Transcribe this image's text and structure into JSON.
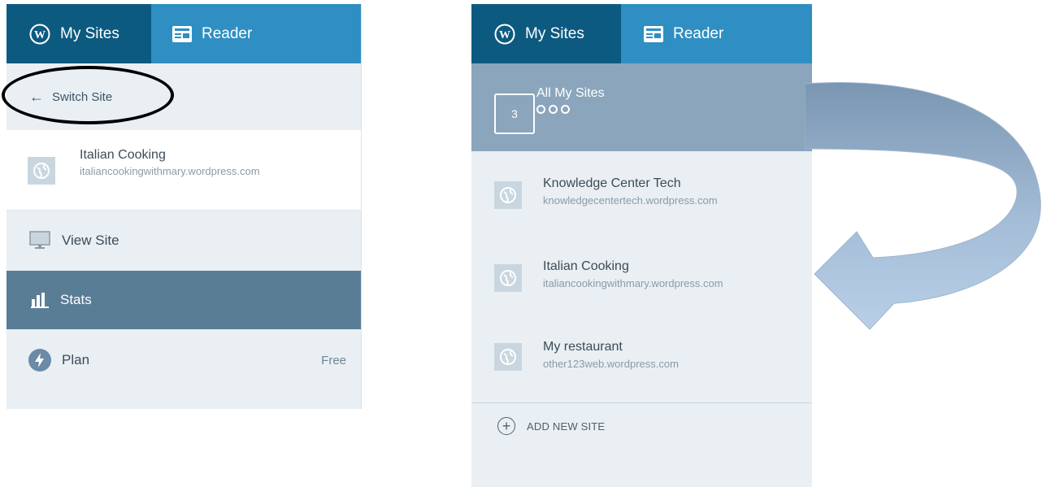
{
  "left": {
    "tabs": {
      "mysites": "My Sites",
      "reader": "Reader"
    },
    "switch_site": "Switch Site",
    "site": {
      "name": "Italian Cooking",
      "url": "italiancookingwithmary.wordpress.com"
    },
    "menu": [
      {
        "label": "View Site",
        "icon": "monitor-icon"
      },
      {
        "label": "Stats",
        "icon": "stats-bars-icon"
      },
      {
        "label": "Plan",
        "icon": "plan-icon",
        "badge": "Free"
      }
    ]
  },
  "right": {
    "tabs": {
      "mysites": "My Sites",
      "reader": "Reader"
    },
    "all_sites": {
      "count": "3",
      "label": "All My Sites"
    },
    "sites": [
      {
        "name": "Knowledge Center Tech",
        "url": "knowledgecentertech.wordpress.com"
      },
      {
        "name": "Italian Cooking",
        "url": "italiancookingwithmary.wordpress.com"
      },
      {
        "name": "My restaurant",
        "url": "other123web.wordpress.com"
      }
    ],
    "add_new_site": "ADD NEW SITE"
  },
  "colors": {
    "mysites_tab": "#0d5a80",
    "reader_tab": "#2f8fc2",
    "panel_bg": "#e9eff3",
    "selected_row": "#5a7d96",
    "all_sites_bg": "#8aa5bc",
    "arrow": "#a9c2e4"
  }
}
